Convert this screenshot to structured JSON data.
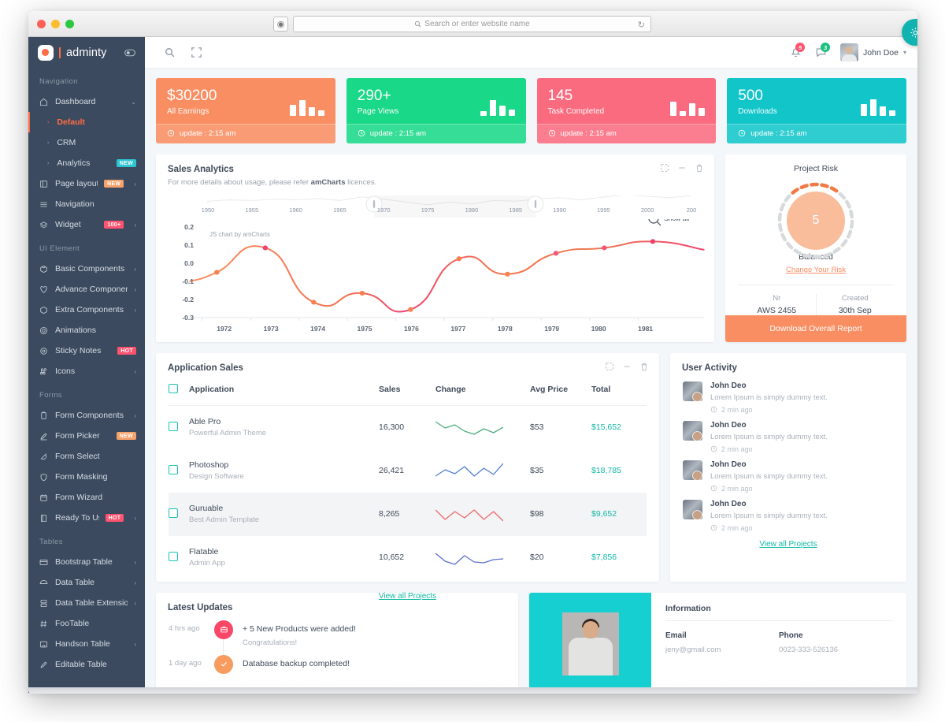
{
  "browser": {
    "address_placeholder": "Search or enter website name",
    "reload_icon": "reload-icon",
    "shield_icon": "shield-icon",
    "newtab_label": "+"
  },
  "sidebar": {
    "brand": "adminty",
    "sections": [
      {
        "title": "Navigation",
        "items": [
          {
            "label": "Dashboard",
            "icon": "home-icon",
            "caret": true
          },
          {
            "label": "Default",
            "sub": true,
            "active": true
          },
          {
            "label": "CRM",
            "sub": true
          },
          {
            "label": "Analytics",
            "sub": true,
            "badge": "NEW",
            "badge_color": "cyan"
          },
          {
            "label": "Page layouts",
            "icon": "layout-icon",
            "badge": "NEW",
            "badge_color": "orange",
            "caret": true
          },
          {
            "label": "Navigation",
            "icon": "menu-icon"
          },
          {
            "label": "Widget",
            "icon": "layers-icon",
            "badge": "100+",
            "badge_color": "pink",
            "caret": true
          }
        ]
      },
      {
        "title": "UI Element",
        "items": [
          {
            "label": "Basic Components",
            "icon": "cube-icon",
            "caret": true
          },
          {
            "label": "Advance Components",
            "icon": "heart-icon",
            "caret": true
          },
          {
            "label": "Extra Components",
            "icon": "box-icon",
            "caret": true
          },
          {
            "label": "Animations",
            "icon": "spiral-icon"
          },
          {
            "label": "Sticky Notes",
            "icon": "gear-icon",
            "badge": "HOT",
            "badge_color": "red"
          },
          {
            "label": "Icons",
            "icon": "command-icon",
            "caret": true
          }
        ]
      },
      {
        "title": "Forms",
        "items": [
          {
            "label": "Form Components",
            "icon": "clipboard-icon",
            "caret": true
          },
          {
            "label": "Form Picker",
            "icon": "pen-icon",
            "badge": "NEW",
            "badge_color": "orange"
          },
          {
            "label": "Form Select",
            "icon": "select-icon"
          },
          {
            "label": "Form Masking",
            "icon": "shield-icon"
          },
          {
            "label": "Form Wizard",
            "icon": "wizard-icon"
          },
          {
            "label": "Ready To Use",
            "icon": "book-icon",
            "badge": "HOT",
            "badge_color": "red",
            "caret": true
          }
        ]
      },
      {
        "title": "Tables",
        "items": [
          {
            "label": "Bootstrap Table",
            "icon": "table-icon",
            "caret": true
          },
          {
            "label": "Data Table",
            "icon": "data-icon",
            "caret": true
          },
          {
            "label": "Data Table Extensions",
            "icon": "ext-icon",
            "caret": true
          },
          {
            "label": "FooTable",
            "icon": "hash-icon"
          },
          {
            "label": "Handson Table",
            "icon": "grid-icon",
            "caret": true
          },
          {
            "label": "Editable Table",
            "icon": "edit-icon"
          }
        ]
      }
    ]
  },
  "topbar": {
    "search_icon": "search-icon",
    "fullscreen_icon": "fullscreen-icon",
    "bell_icon": "bell-icon",
    "bell_count": "5",
    "chat_icon": "chat-icon",
    "chat_count": "3",
    "user_name": "John Doe",
    "chevron": "chevron-down-icon"
  },
  "stats": [
    {
      "value": "$30200",
      "label": "All Earnings",
      "footer": "update : 2:15 am",
      "color": "#f98e62",
      "bars": [
        14,
        20,
        11,
        7
      ]
    },
    {
      "value": "290+",
      "label": "Page Views",
      "footer": "update : 2:15 am",
      "color": "#19d888",
      "bars": [
        6,
        20,
        13,
        8
      ]
    },
    {
      "value": "145",
      "label": "Task Completed",
      "footer": "update : 2:15 am",
      "color": "#fa6b7f",
      "bars": [
        18,
        6,
        16,
        10
      ]
    },
    {
      "value": "500",
      "label": "Downloads",
      "footer": "update : 2:15 am",
      "color": "#11c5c9",
      "bars": [
        15,
        21,
        12,
        7
      ]
    }
  ],
  "sales_analytics": {
    "title": "Sales Analytics",
    "subtitle_pre": "For more details about usage, please refer ",
    "subtitle_bold": "amCharts",
    "subtitle_post": " licences.",
    "tools": [
      "fullscreen-icon",
      "minimize-icon",
      "trash-icon"
    ],
    "watermark": "JS chart by amCharts",
    "showall_label": "Show all"
  },
  "chart_data": {
    "type": "line",
    "title": "Sales Analytics",
    "xlabel": "",
    "ylabel": "",
    "x": [
      1972,
      1973,
      1974,
      1975,
      1976,
      1977,
      1978,
      1979,
      1980,
      1981
    ],
    "values": [
      -0.05,
      0.085,
      -0.215,
      -0.165,
      -0.255,
      0.025,
      -0.06,
      0.055,
      0.085,
      0.12
    ],
    "ytick_labels": [
      "0.2",
      "0.1",
      "0.0",
      "-0.1",
      "-0.2",
      "-0.3"
    ],
    "ylim": [
      -0.3,
      0.2
    ],
    "xtick_labels": [
      "1972",
      "1973",
      "1974",
      "1975",
      "1976",
      "1977",
      "1978",
      "1979",
      "1980",
      "1981"
    ],
    "scrollbar_ticks": [
      "1950",
      "1955",
      "1960",
      "1965",
      "1970",
      "1975",
      "1980",
      "1985",
      "1990",
      "1995",
      "2000",
      "200"
    ],
    "line_color_start": "#f98e62",
    "line_color_end": "#f0426c",
    "grid": false,
    "legend": "none"
  },
  "project_risk": {
    "title": "Project Risk",
    "value": "5",
    "state": "Balanced",
    "link": "Change Your Risk",
    "meta": [
      {
        "key": "Nr",
        "value": "AWS 2455"
      },
      {
        "key": "Created",
        "value": "30th Sep"
      }
    ],
    "button": "Download Overall Report",
    "settings_icon": "gear-icon"
  },
  "application_sales": {
    "title": "Application Sales",
    "tools": [
      "fullscreen-icon",
      "minimize-icon",
      "trash-icon"
    ],
    "columns": [
      "Application",
      "Sales",
      "Change",
      "Avg Price",
      "Total"
    ],
    "rows": [
      {
        "name": "Able Pro",
        "desc": "Powerful Admin Theme",
        "sales": "16,300",
        "avg_price": "$53",
        "total": "$15,652",
        "spark_color": "#4caf7d",
        "spark": [
          18,
          10,
          14,
          6,
          2,
          9,
          4,
          11
        ]
      },
      {
        "name": "Photoshop",
        "desc": "Design Software",
        "sales": "26,421",
        "avg_price": "$35",
        "total": "$18,785",
        "spark_color": "#4f7fd4",
        "spark": [
          4,
          12,
          7,
          16,
          4,
          14,
          6,
          20
        ]
      },
      {
        "name": "Guruable",
        "desc": "Best Admin Template",
        "sales": "8,265",
        "avg_price": "$98",
        "total": "$9,652",
        "spark_color": "#ea6a6a",
        "spark": [
          16,
          4,
          14,
          6,
          16,
          4,
          14,
          2
        ]
      },
      {
        "name": "Flatable",
        "desc": "Admin App",
        "sales": "10,652",
        "avg_price": "$20",
        "total": "$7,856",
        "spark_color": "#5b6fd0",
        "spark": [
          16,
          6,
          2,
          13,
          5,
          4,
          8,
          9
        ]
      }
    ],
    "view_all": "View all Projects"
  },
  "user_activity": {
    "title": "User Activity",
    "items": [
      {
        "name": "John Deo",
        "text": "Lorem Ipsum is simply dummy text.",
        "time": "2 min ago"
      },
      {
        "name": "John Deo",
        "text": "Lorem Ipsum is simply dummy text.",
        "time": "2 min ago"
      },
      {
        "name": "John Deo",
        "text": "Lorem Ipsum is simply dummy text.",
        "time": "2 min ago"
      },
      {
        "name": "John Deo",
        "text": "Lorem Ipsum is simply dummy text.",
        "time": "2 min ago"
      }
    ],
    "view_all": "View all Projects"
  },
  "latest_updates": {
    "title": "Latest Updates",
    "items": [
      {
        "time": "4 hrs ago",
        "icon": "briefcase-icon",
        "color": "pink",
        "main": "+ 5 New Products were added!",
        "sub": "Congratulations!"
      },
      {
        "time": "1 day ago",
        "icon": "check-icon",
        "color": "orange",
        "main": "Database backup completed!",
        "sub": ""
      }
    ]
  },
  "information": {
    "title": "Information",
    "fields": [
      {
        "key": "Email",
        "value": "jeny@gmail.com"
      },
      {
        "key": "Phone",
        "value": "0023-333-526136"
      }
    ]
  }
}
